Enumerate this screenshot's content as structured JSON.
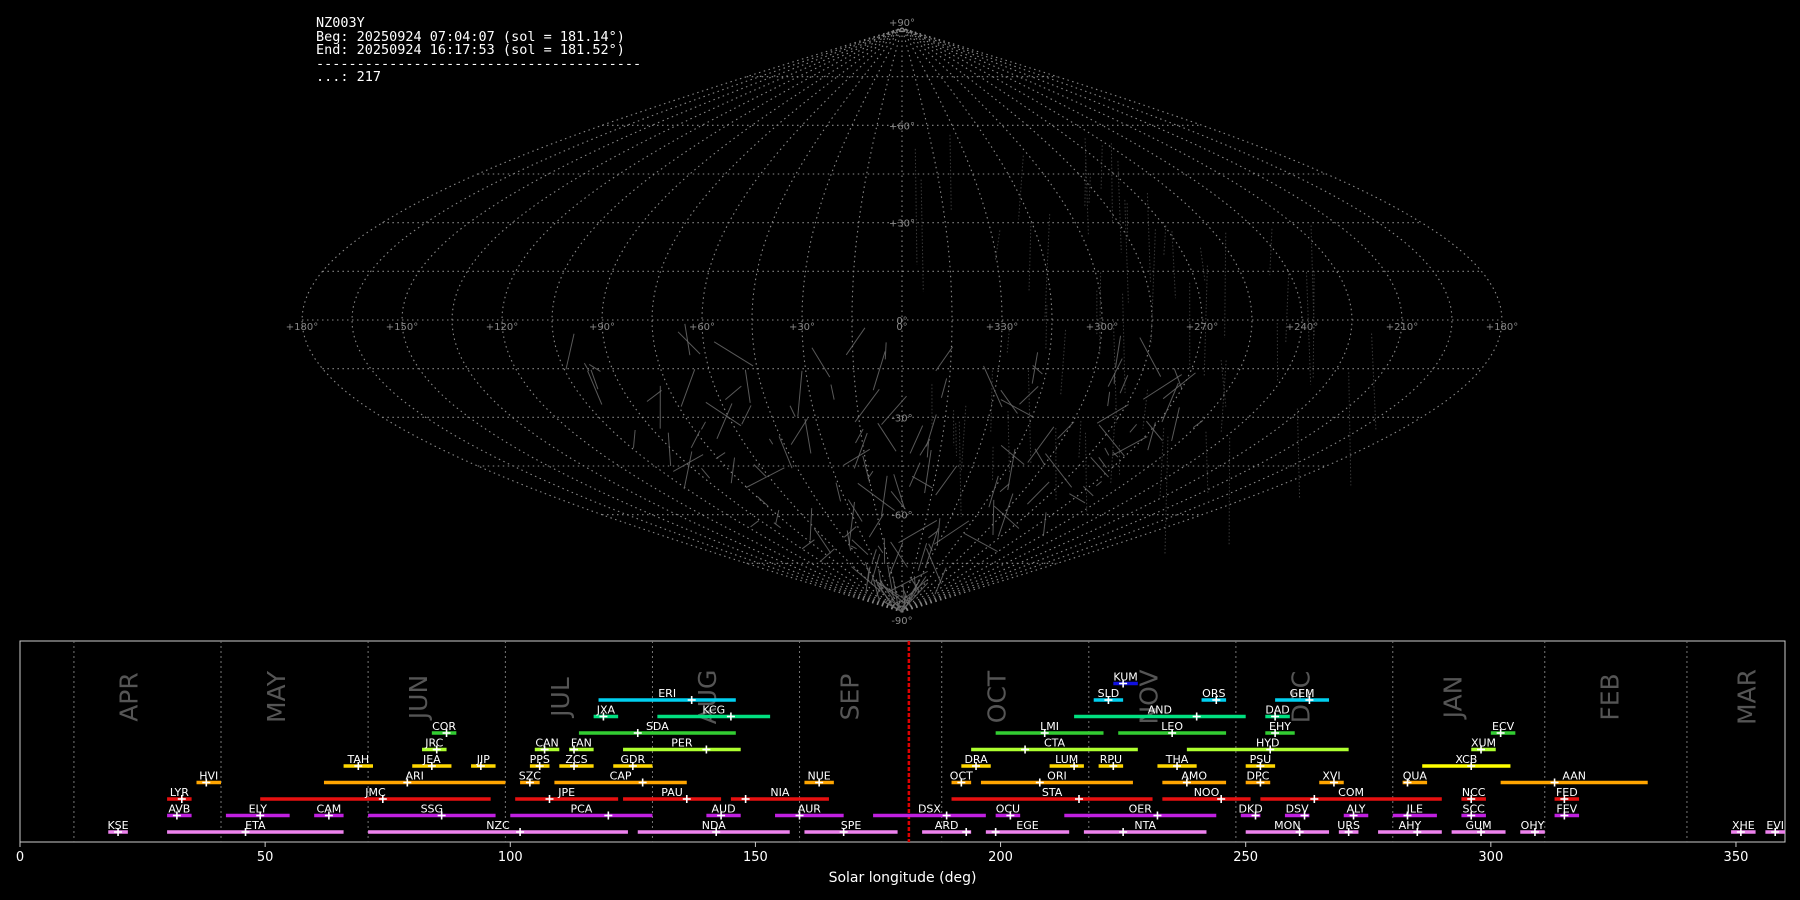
{
  "info": {
    "station": "NZ003Y",
    "begin": "Beg: 20250924 07:04:07 (sol = 181.14°)",
    "end": "End: 20250924 16:17:53 (sol = 181.52°)",
    "separator": "----------------------------------------",
    "count": "...: 217"
  },
  "chart_data": [
    {
      "type": "sky_map_sinusoidal",
      "lat_labels": [
        "+90°",
        "+60°",
        "+30°",
        "0°",
        "-30°",
        "-60°",
        "-90°"
      ],
      "lon_labels": [
        "+180°",
        "+150°",
        "+120°",
        "+90°",
        "+60°",
        "+30°",
        "0°",
        "+330°",
        "+300°",
        "+270°",
        "+240°",
        "+210°",
        "+180°"
      ]
    },
    {
      "type": "timeline_bars",
      "xlabel": "Solar longitude (deg)",
      "xlim": [
        0,
        360
      ],
      "xticks": [
        0,
        50,
        100,
        150,
        200,
        250,
        300,
        350
      ],
      "current_sol": 181.3,
      "months": [
        {
          "name": "APR",
          "sol": 24
        },
        {
          "name": "MAY",
          "sol": 54
        },
        {
          "name": "JUN",
          "sol": 83
        },
        {
          "name": "JUL",
          "sol": 112
        },
        {
          "name": "AUG",
          "sol": 142
        },
        {
          "name": "SEP",
          "sol": 171
        },
        {
          "name": "OCT",
          "sol": 201
        },
        {
          "name": "NOV",
          "sol": 232
        },
        {
          "name": "DEC",
          "sol": 263
        },
        {
          "name": "JAN",
          "sol": 294
        },
        {
          "name": "FEB",
          "sol": 326
        },
        {
          "name": "MAR",
          "sol": 354
        }
      ],
      "month_boundaries": [
        11,
        41,
        71,
        99,
        129,
        159,
        188,
        218,
        248,
        280,
        311,
        340
      ],
      "colors": {
        "KSE": "#ee82ee",
        "SPE": "#ee82ee",
        "NTA": "#ee82ee",
        "ETA": "#ee82ee",
        "NZC": "#ee82ee",
        "NDA": "#ee82ee",
        "ARD": "#ee82ee",
        "EGE": "#ee82ee",
        "MON": "#ee82ee",
        "URS": "#ee82ee",
        "AHY": "#ee82ee",
        "GUM": "#ee82ee",
        "OHY": "#ee82ee",
        "XHE": "#ee82ee",
        "EVI": "#ee82ee",
        "AVB": "#c020e0",
        "ELY": "#c020e0",
        "CAM": "#c020e0",
        "SSG": "#c020e0",
        "PCA": "#c020e0",
        "AUD": "#c020e0",
        "AUR": "#c020e0",
        "DSX": "#c020e0",
        "OCU": "#c020e0",
        "OER": "#c020e0",
        "DKD": "#c020e0",
        "DSV": "#c020e0",
        "ALY": "#c020e0",
        "JLE": "#c020e0",
        "SCC": "#c020e0",
        "FEV": "#c020e0",
        "LYR": "#e81010",
        "JMC": "#e81010",
        "JPE": "#e81010",
        "PAU": "#e81010",
        "NIA": "#e81010",
        "STA": "#e81010",
        "NOO": "#e81010",
        "COM": "#e81010",
        "NCC": "#e81010",
        "FED": "#e81010",
        "HVI": "#ffa500",
        "ARI": "#ffa500",
        "SZC": "#ffa500",
        "CAP": "#ffa500",
        "NUE": "#ffa500",
        "OCT": "#ffa500",
        "ORI": "#ffa500",
        "AMO": "#ffa500",
        "DPC": "#ffa500",
        "XVI": "#ffa500",
        "QUA": "#ffa500",
        "AAN": "#ffa500",
        "TAH": "#ffd700",
        "JEA": "#ffd700",
        "JIP": "#ffd700",
        "PPS": "#ffd700",
        "ZCS": "#ffd700",
        "GDR": "#ffd700",
        "DRA": "#ffd700",
        "LUM": "#ffd700",
        "RPU": "#ffd700",
        "THA": "#ffd700",
        "PSU": "#ffd700",
        "XCB": "#ffff00",
        "JRC": "#adff2f",
        "CAN": "#adff2f",
        "FAN": "#adff2f",
        "PER": "#adff2f",
        "CTA": "#adff2f",
        "HYD": "#adff2f",
        "XUM": "#adff2f",
        "COR": "#32cd32",
        "SDA": "#32cd32",
        "LMI": "#32cd32",
        "LEO": "#32cd32",
        "EHY": "#32cd32",
        "ECV": "#32cd32",
        "JXA": "#00e080",
        "KCG": "#00e080",
        "AND": "#00e080",
        "DAD": "#00e080",
        "ERI": "#00d0f0",
        "SLD": "#00d0f0",
        "ORS": "#00d0f0",
        "GEM": "#00d0f0",
        "KUM": "#1010e0"
      },
      "showers": [
        {
          "code": "KSE",
          "start": 18,
          "end": 22,
          "peak": 20,
          "row": 0
        },
        {
          "code": "ETA",
          "start": 30,
          "end": 66,
          "peak": 46,
          "row": 0
        },
        {
          "code": "NZC",
          "start": 71,
          "end": 124,
          "peak": 102,
          "row": 0
        },
        {
          "code": "NDA",
          "start": 126,
          "end": 157,
          "peak": 142,
          "row": 0
        },
        {
          "code": "SPE",
          "start": 160,
          "end": 179,
          "peak": 168,
          "row": 0
        },
        {
          "code": "ARD",
          "start": 184,
          "end": 194,
          "peak": 193,
          "row": 0
        },
        {
          "code": "EGE",
          "start": 197,
          "end": 214,
          "peak": 199,
          "row": 0
        },
        {
          "code": "NTA",
          "start": 217,
          "end": 242,
          "peak": 225,
          "row": 0
        },
        {
          "code": "MON",
          "start": 250,
          "end": 267,
          "peak": 261,
          "row": 0
        },
        {
          "code": "URS",
          "start": 269,
          "end": 273,
          "peak": 271,
          "row": 0
        },
        {
          "code": "AHY",
          "start": 277,
          "end": 290,
          "peak": 285,
          "row": 0
        },
        {
          "code": "GUM",
          "start": 292,
          "end": 303,
          "peak": 298,
          "row": 0
        },
        {
          "code": "OHY",
          "start": 306,
          "end": 311,
          "peak": 309,
          "row": 0
        },
        {
          "code": "XHE",
          "start": 349,
          "end": 354,
          "peak": 351,
          "row": 0
        },
        {
          "code": "EVI",
          "start": 356,
          "end": 360,
          "peak": 358,
          "row": 0
        },
        {
          "code": "AVB",
          "start": 30,
          "end": 35,
          "peak": 32,
          "row": 1
        },
        {
          "code": "ELY",
          "start": 42,
          "end": 55,
          "peak": 49,
          "row": 1
        },
        {
          "code": "CAM",
          "start": 60,
          "end": 66,
          "peak": 63,
          "row": 1
        },
        {
          "code": "SSG",
          "start": 71,
          "end": 97,
          "peak": 86,
          "row": 1
        },
        {
          "code": "PCA",
          "start": 100,
          "end": 129,
          "peak": 120,
          "row": 1
        },
        {
          "code": "AUD",
          "start": 140,
          "end": 147,
          "peak": 143,
          "row": 1
        },
        {
          "code": "AUR",
          "start": 154,
          "end": 168,
          "peak": 159,
          "row": 1
        },
        {
          "code": "DSX",
          "start": 174,
          "end": 197,
          "peak": 189,
          "row": 1
        },
        {
          "code": "OCU",
          "start": 199,
          "end": 204,
          "peak": 202,
          "row": 1
        },
        {
          "code": "OER",
          "start": 213,
          "end": 244,
          "peak": 232,
          "row": 1
        },
        {
          "code": "DKD",
          "start": 249,
          "end": 253,
          "peak": 252,
          "row": 1
        },
        {
          "code": "DSV",
          "start": 258,
          "end": 263,
          "peak": 262,
          "row": 1
        },
        {
          "code": "ALY",
          "start": 270,
          "end": 275,
          "peak": 272,
          "row": 1
        },
        {
          "code": "JLE",
          "start": 280,
          "end": 289,
          "peak": 283,
          "row": 1
        },
        {
          "code": "SCC",
          "start": 294,
          "end": 299,
          "peak": 296,
          "row": 1
        },
        {
          "code": "FEV",
          "start": 313,
          "end": 318,
          "peak": 315,
          "row": 1
        },
        {
          "code": "LYR",
          "start": 30,
          "end": 35,
          "peak": 33,
          "row": 2
        },
        {
          "code": "JMC",
          "start": 49,
          "end": 96,
          "peak": 74,
          "row": 2
        },
        {
          "code": "JPE",
          "start": 101,
          "end": 122,
          "peak": 108,
          "row": 2
        },
        {
          "code": "PAU",
          "start": 123,
          "end": 143,
          "peak": 136,
          "row": 2
        },
        {
          "code": "NIA",
          "start": 145,
          "end": 165,
          "peak": 148,
          "row": 2
        },
        {
          "code": "STA",
          "start": 190,
          "end": 231,
          "peak": 216,
          "row": 2
        },
        {
          "code": "NOO",
          "start": 233,
          "end": 251,
          "peak": 245,
          "row": 2
        },
        {
          "code": "COM",
          "start": 253,
          "end": 290,
          "peak": 264,
          "row": 2
        },
        {
          "code": "NCC",
          "start": 294,
          "end": 299,
          "peak": 296,
          "row": 2
        },
        {
          "code": "FED",
          "start": 313,
          "end": 318,
          "peak": 315,
          "row": 2
        },
        {
          "code": "HVI",
          "start": 36,
          "end": 41,
          "peak": 38,
          "row": 3
        },
        {
          "code": "ARI",
          "start": 62,
          "end": 99,
          "peak": 79,
          "row": 3
        },
        {
          "code": "SZC",
          "start": 102,
          "end": 106,
          "peak": 104,
          "row": 3
        },
        {
          "code": "CAP",
          "start": 109,
          "end": 136,
          "peak": 127,
          "row": 3
        },
        {
          "code": "NUE",
          "start": 160,
          "end": 166,
          "peak": 163,
          "row": 3
        },
        {
          "code": "OCT",
          "start": 190,
          "end": 194,
          "peak": 192,
          "row": 3
        },
        {
          "code": "ORI",
          "start": 196,
          "end": 227,
          "peak": 208,
          "row": 3
        },
        {
          "code": "AMO",
          "start": 233,
          "end": 246,
          "peak": 238,
          "row": 3
        },
        {
          "code": "DPC",
          "start": 250,
          "end": 255,
          "peak": 253,
          "row": 3
        },
        {
          "code": "XVI",
          "start": 265,
          "end": 270,
          "peak": 268,
          "row": 3
        },
        {
          "code": "QUA",
          "start": 282,
          "end": 287,
          "peak": 283,
          "row": 3
        },
        {
          "code": "AAN",
          "start": 302,
          "end": 332,
          "peak": 313,
          "row": 3
        },
        {
          "code": "TAH",
          "start": 66,
          "end": 72,
          "peak": 69,
          "row": 4
        },
        {
          "code": "JEA",
          "start": 80,
          "end": 88,
          "peak": 84,
          "row": 4
        },
        {
          "code": "JIP",
          "start": 92,
          "end": 97,
          "peak": 94,
          "row": 4
        },
        {
          "code": "PPS",
          "start": 104,
          "end": 108,
          "peak": 106,
          "row": 4
        },
        {
          "code": "ZCS",
          "start": 110,
          "end": 117,
          "peak": 113,
          "row": 4
        },
        {
          "code": "GDR",
          "start": 121,
          "end": 129,
          "peak": 125,
          "row": 4
        },
        {
          "code": "DRA",
          "start": 192,
          "end": 198,
          "peak": 195,
          "row": 4
        },
        {
          "code": "LUM",
          "start": 210,
          "end": 217,
          "peak": 215,
          "row": 4
        },
        {
          "code": "RPU",
          "start": 220,
          "end": 225,
          "peak": 223,
          "row": 4
        },
        {
          "code": "THA",
          "start": 232,
          "end": 240,
          "peak": 236,
          "row": 4
        },
        {
          "code": "PSU",
          "start": 250,
          "end": 256,
          "peak": 253,
          "row": 4
        },
        {
          "code": "XCB",
          "start": 286,
          "end": 304,
          "peak": 296,
          "row": 4
        },
        {
          "code": "JRC",
          "start": 82,
          "end": 87,
          "peak": 85,
          "row": 5
        },
        {
          "code": "CAN",
          "start": 105,
          "end": 110,
          "peak": 107,
          "row": 5
        },
        {
          "code": "FAN",
          "start": 112,
          "end": 117,
          "peak": 113,
          "row": 5
        },
        {
          "code": "PER",
          "start": 123,
          "end": 147,
          "peak": 140,
          "row": 5
        },
        {
          "code": "CTA",
          "start": 194,
          "end": 228,
          "peak": 205,
          "row": 5
        },
        {
          "code": "HYD",
          "start": 238,
          "end": 271,
          "peak": 255,
          "row": 5
        },
        {
          "code": "XUM",
          "start": 296,
          "end": 301,
          "peak": 298,
          "row": 5
        },
        {
          "code": "COR",
          "start": 84,
          "end": 89,
          "peak": 87,
          "row": 6
        },
        {
          "code": "SDA",
          "start": 114,
          "end": 146,
          "peak": 126,
          "row": 6
        },
        {
          "code": "LMI",
          "start": 199,
          "end": 221,
          "peak": 209,
          "row": 6
        },
        {
          "code": "LEO",
          "start": 224,
          "end": 246,
          "peak": 235,
          "row": 6
        },
        {
          "code": "EHY",
          "start": 254,
          "end": 260,
          "peak": 256,
          "row": 6
        },
        {
          "code": "ECV",
          "start": 300,
          "end": 305,
          "peak": 302,
          "row": 6
        },
        {
          "code": "JXA",
          "start": 117,
          "end": 122,
          "peak": 119,
          "row": 7
        },
        {
          "code": "KCG",
          "start": 130,
          "end": 153,
          "peak": 145,
          "row": 7
        },
        {
          "code": "AND",
          "start": 215,
          "end": 250,
          "peak": 240,
          "row": 7
        },
        {
          "code": "DAD",
          "start": 254,
          "end": 259,
          "peak": 256,
          "row": 7
        },
        {
          "code": "ERI",
          "start": 118,
          "end": 146,
          "peak": 137,
          "row": 8
        },
        {
          "code": "SLD",
          "start": 219,
          "end": 225,
          "peak": 222,
          "row": 8
        },
        {
          "code": "ORS",
          "start": 241,
          "end": 246,
          "peak": 244,
          "row": 8
        },
        {
          "code": "GEM",
          "start": 256,
          "end": 267,
          "peak": 263,
          "row": 8
        },
        {
          "code": "KUM",
          "start": 223,
          "end": 228,
          "peak": 225,
          "row": 9
        }
      ]
    }
  ]
}
